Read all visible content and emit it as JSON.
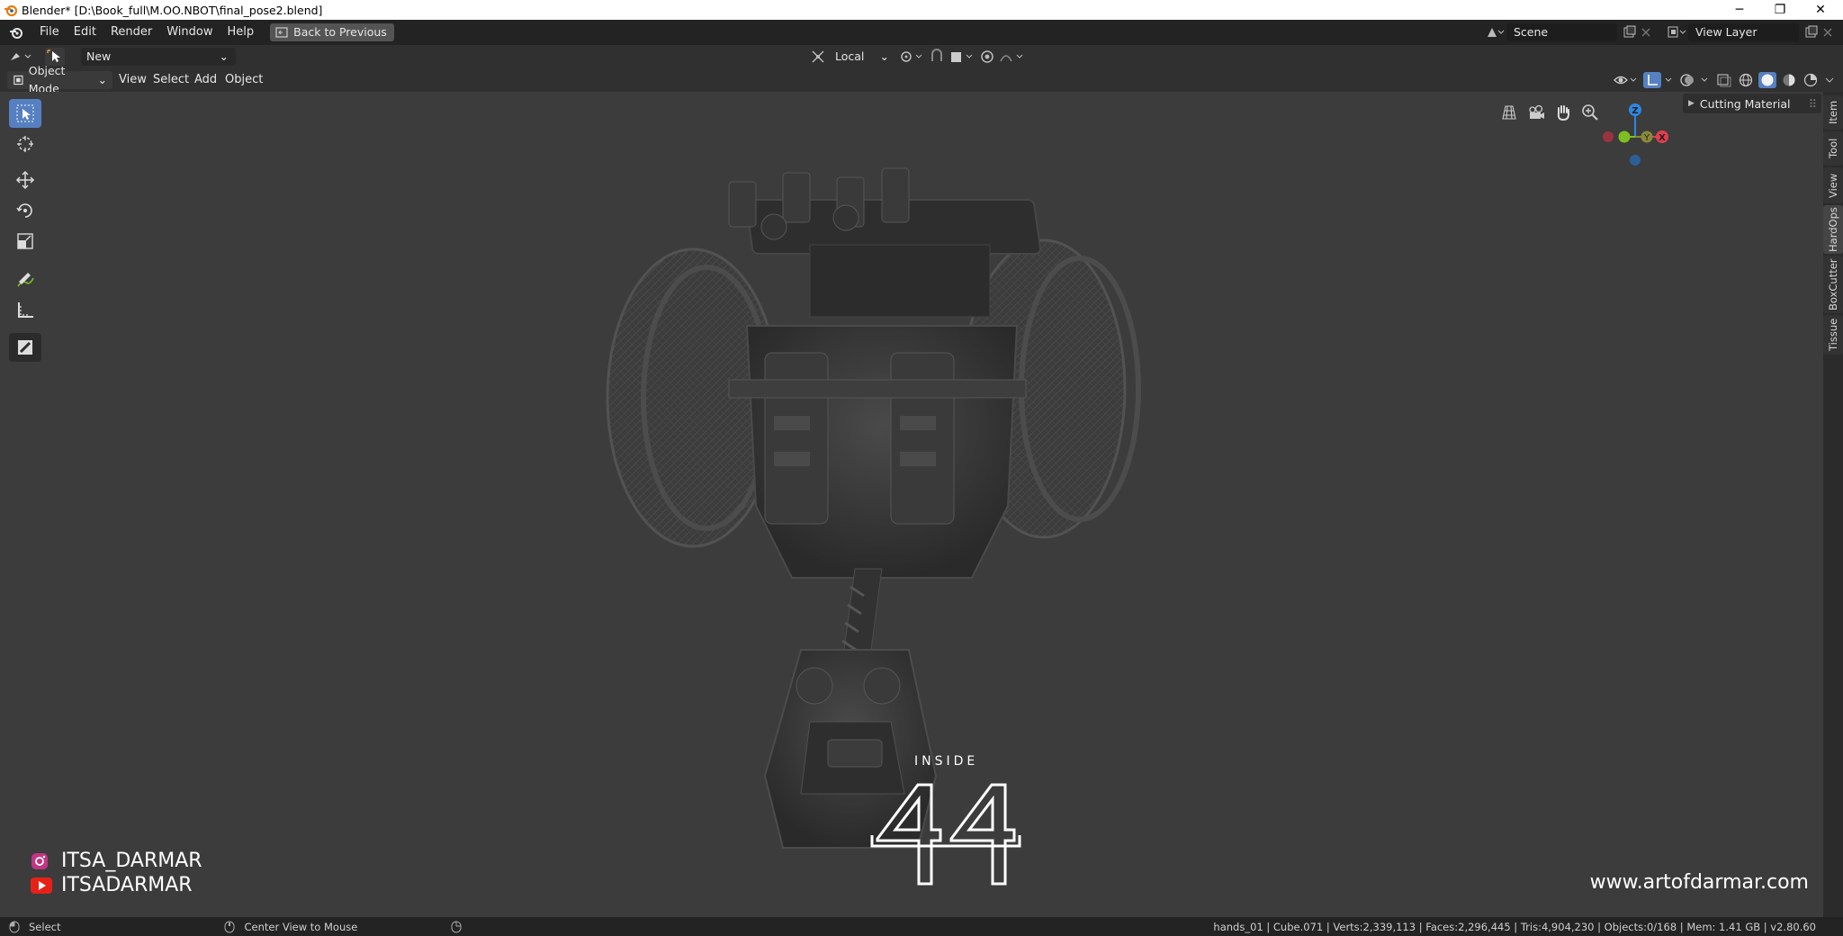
{
  "window": {
    "title": "Blender* [D:\\Book_full\\M.OO.NBOT\\final_pose2.blend]",
    "minimize": "─",
    "restore": "❐",
    "close": "✕"
  },
  "topbar": {
    "menus": [
      "File",
      "Edit",
      "Render",
      "Window",
      "Help"
    ],
    "back_label": "Back to Previous",
    "scene_label": "Scene",
    "view_layer_label": "View Layer"
  },
  "tool_header": {
    "brush_value": "New",
    "orientation_value": "Local"
  },
  "view_header": {
    "mode_label": "Object Mode",
    "menus": [
      "View",
      "Select",
      "Add",
      "Object"
    ]
  },
  "sidebar_panel": {
    "panel_label": "Cutting Material",
    "tabs": [
      "Item",
      "Tool",
      "View",
      "HardOps",
      "BoxCutter",
      "Tissue"
    ]
  },
  "gizmo": {
    "z_label": "Z",
    "x_label": "X",
    "y_label": "Y",
    "colors": {
      "x": "#e23e4d",
      "y": "#7fbf22",
      "z": "#2d87e2"
    }
  },
  "overlay": {
    "instagram": "ITSA_DARMAR",
    "youtube": "ITSADARMAR",
    "website": "www.artofdarmar.com",
    "logo_top": "INSIDE"
  },
  "statusbar": {
    "left_action": "Select",
    "middle_action": "Center View to Mouse",
    "stats": "hands_01 | Cube.071 | Verts:2,339,113 | Faces:2,296,445 | Tris:4,904,230 | Objects:0/168 | Mem: 1.41 GB | v2.80.60"
  },
  "accent": "#5680c2"
}
